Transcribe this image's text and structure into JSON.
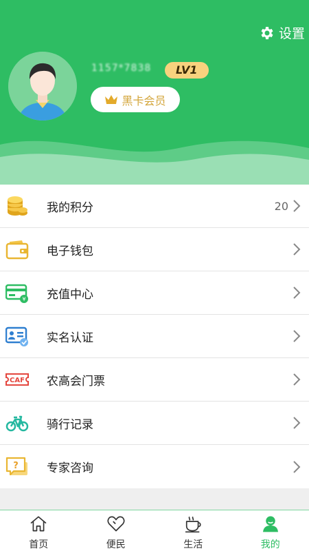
{
  "header": {
    "settings_label": "设置",
    "user_id": "1157*7838",
    "level_badge": "LV1",
    "vip_label": "黑卡会员"
  },
  "menu": {
    "items": [
      {
        "label": "我的积分",
        "value": "20",
        "icon": "coins-icon"
      },
      {
        "label": "电子钱包",
        "icon": "wallet-icon"
      },
      {
        "label": "充值中心",
        "icon": "recharge-card-icon"
      },
      {
        "label": "实名认证",
        "icon": "id-card-icon"
      },
      {
        "label": "农高会门票",
        "icon": "ticket-icon"
      },
      {
        "label": "骑行记录",
        "icon": "bicycle-icon"
      },
      {
        "label": "专家咨询",
        "icon": "question-chat-icon"
      }
    ]
  },
  "tabbar": {
    "tabs": [
      {
        "label": "首页",
        "icon": "home-icon",
        "active": false
      },
      {
        "label": "便民",
        "icon": "heart-icon",
        "active": false
      },
      {
        "label": "生活",
        "icon": "coffee-cup-icon",
        "active": false
      },
      {
        "label": "我的",
        "icon": "user-icon",
        "active": true
      }
    ]
  },
  "colors": {
    "brand_green": "#2ebd63",
    "level_badge_bg": "#f8d27e",
    "vip_gold": "#d3a53a"
  }
}
